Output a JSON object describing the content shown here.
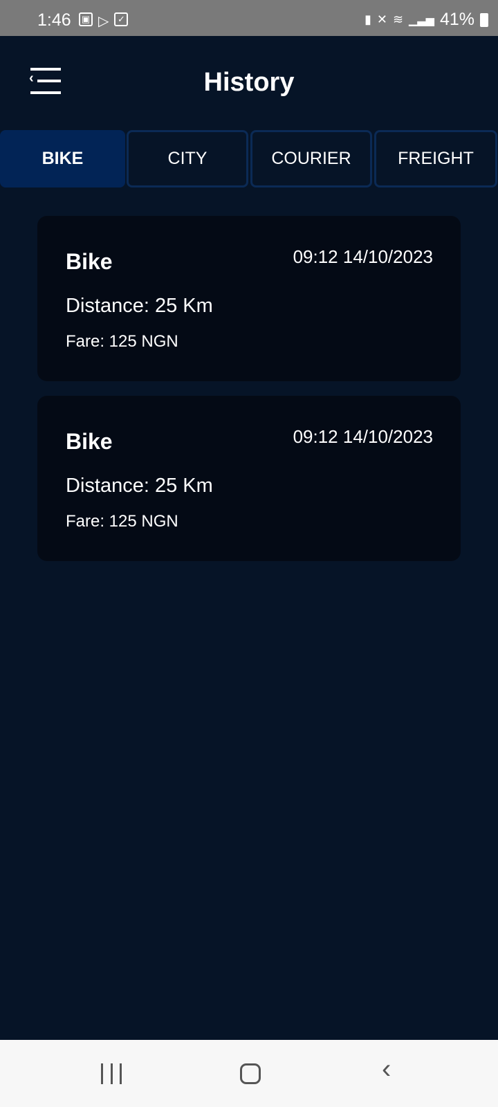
{
  "status_bar": {
    "time": "1:46",
    "battery": "41%"
  },
  "header": {
    "title": "History"
  },
  "tabs": [
    {
      "label": "BIKE",
      "active": true
    },
    {
      "label": "CITY"
    },
    {
      "label": "COURIER"
    },
    {
      "label": "FREIGHT"
    }
  ],
  "trips": [
    {
      "type": "Bike",
      "datetime": "09:12 14/10/2023",
      "distance": "Distance: 25 Km",
      "fare": "Fare: 125 NGN"
    },
    {
      "type": "Bike",
      "datetime": "09:12 14/10/2023",
      "distance": "Distance: 25 Km",
      "fare": "Fare: 125 NGN"
    }
  ],
  "colors": {
    "background": "#061427",
    "active_tab": "#022456",
    "card": "#040a15"
  }
}
